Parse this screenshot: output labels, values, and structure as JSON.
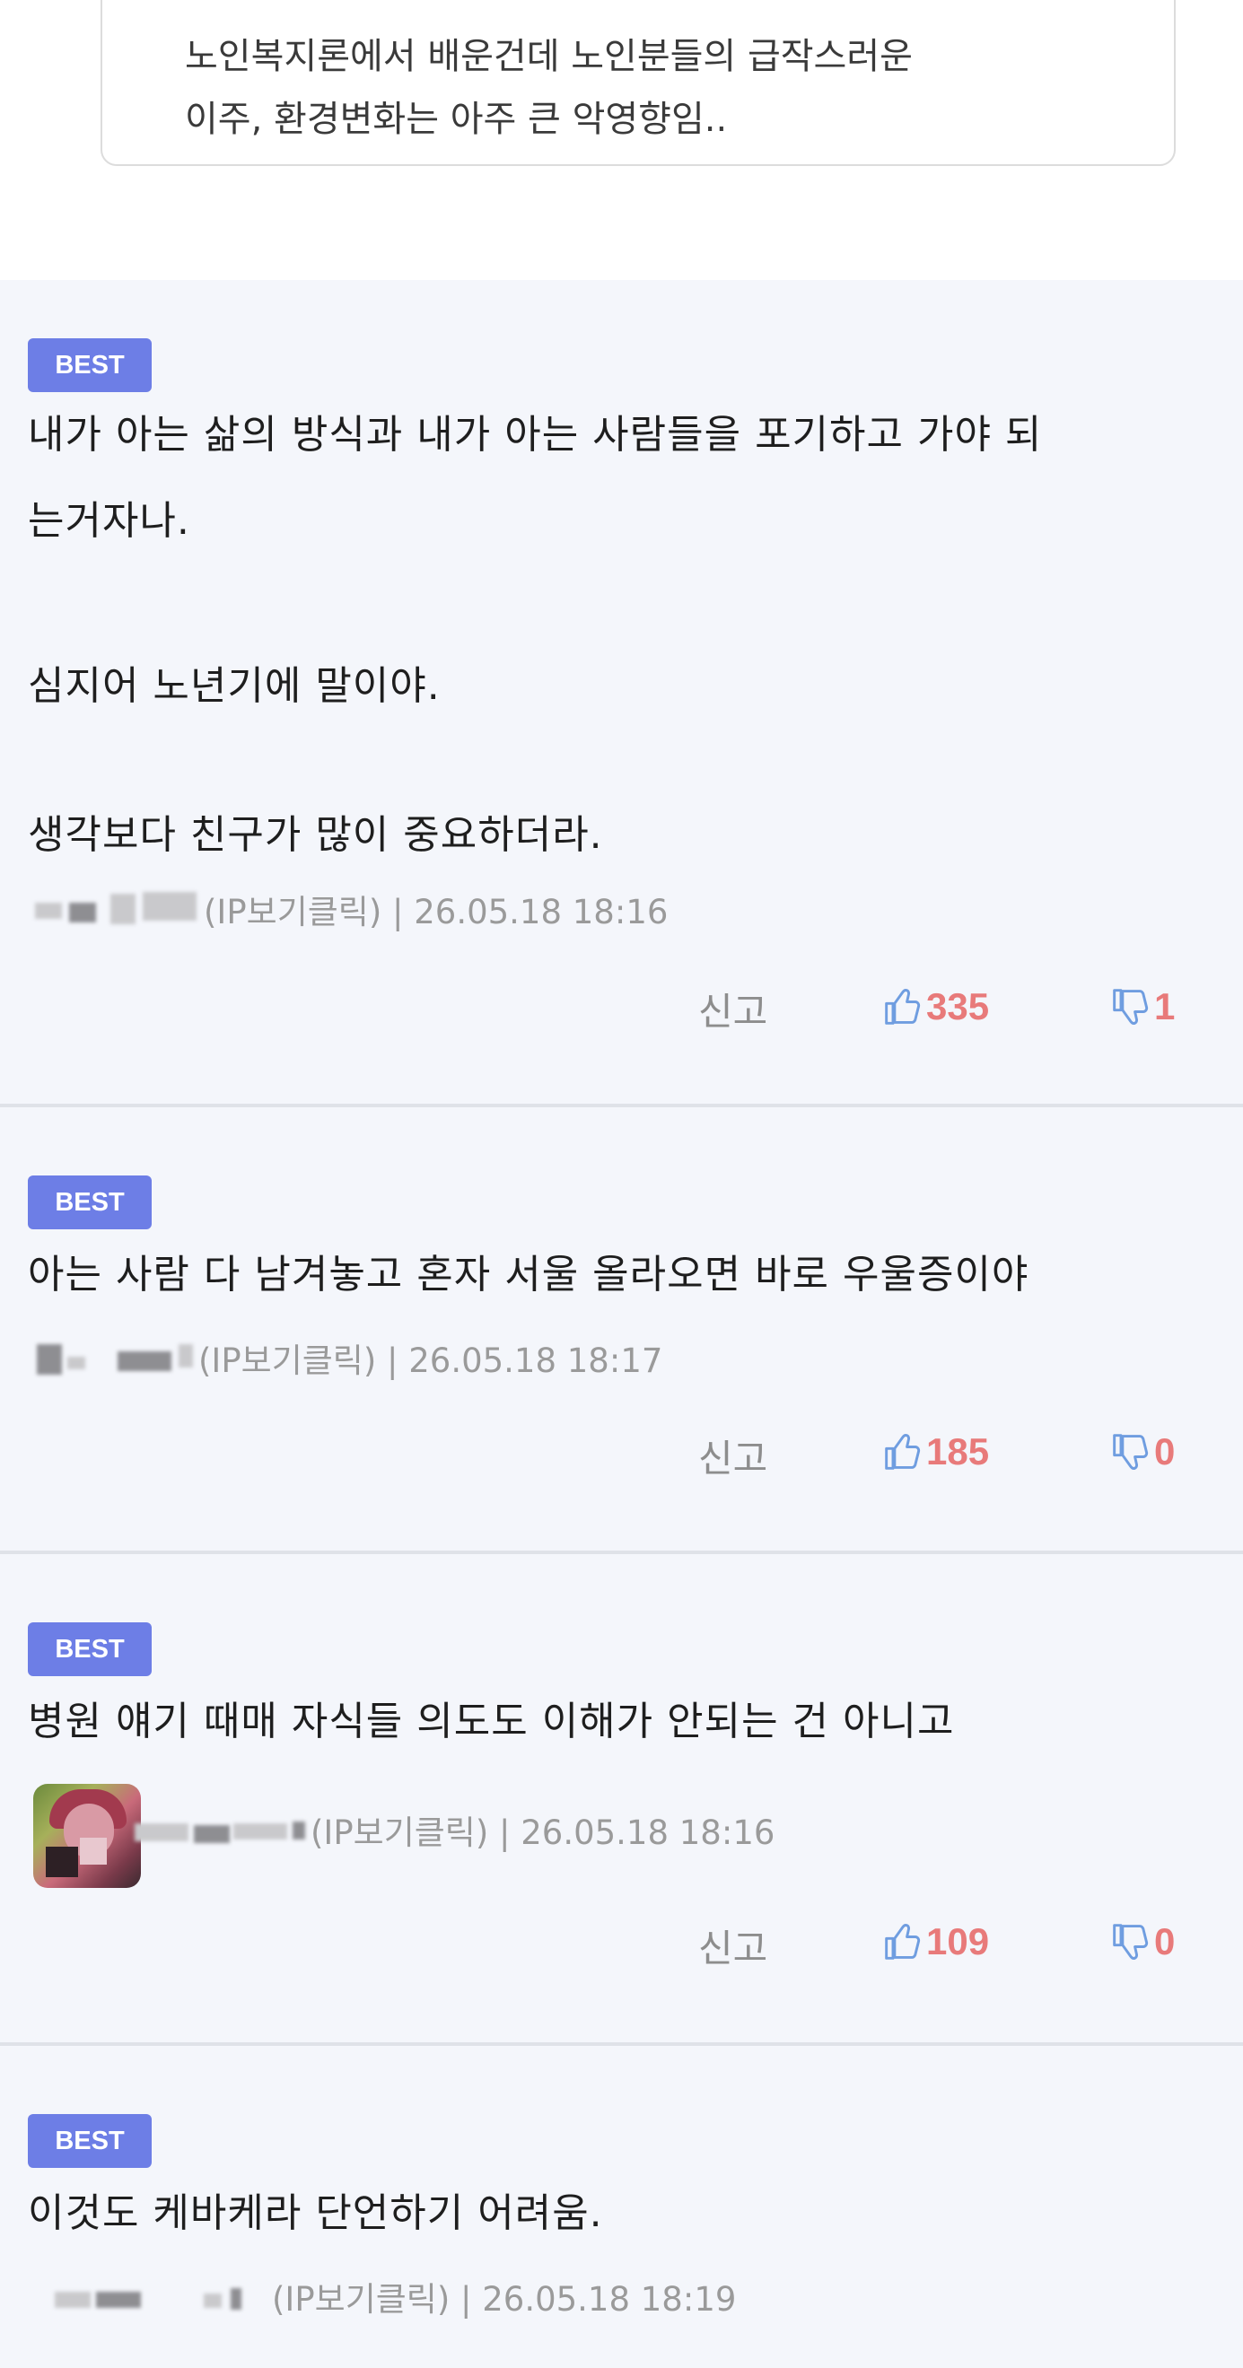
{
  "quote": {
    "line1": "노인복지론에서 배운건데 노인분들의 급작스러운",
    "line2": "이주, 환경변화는 아주 큰 악영향임.."
  },
  "colors": {
    "badge": "#6d7ee6",
    "count": "#e87a7a",
    "thumb": "#6f9de0",
    "background": "#f4f6fb"
  },
  "comments": [
    {
      "badge": "BEST",
      "lines": [
        "내가 아는 삶의 방식과 내가 아는 사람들을 포기하고 가야 되",
        "는거자나.",
        "",
        "심지어 노년기에 말이야.",
        "",
        "생각보다 친구가 많이 중요하더라."
      ],
      "meta": "(IP보기클릭) | 26.05.18 18:16",
      "report_label": "신고",
      "likes": "335",
      "dislikes": "1"
    },
    {
      "badge": "BEST",
      "lines": [
        "아는 사람 다 남겨놓고 혼자 서울 올라오면 바로 우울증이야"
      ],
      "meta": "(IP보기클릭) | 26.05.18 18:17",
      "report_label": "신고",
      "likes": "185",
      "dislikes": "0"
    },
    {
      "badge": "BEST",
      "lines": [
        "병원 얘기 때매 자식들 의도도 이해가 안되는 건 아니고"
      ],
      "meta": "(IP보기클릭) | 26.05.18 18:16",
      "report_label": "신고",
      "likes": "109",
      "dislikes": "0"
    },
    {
      "badge": "BEST",
      "lines": [
        "이것도 케바케라 단언하기 어려움."
      ],
      "meta": "(IP보기클릭) | 26.05.18 18:19"
    }
  ]
}
